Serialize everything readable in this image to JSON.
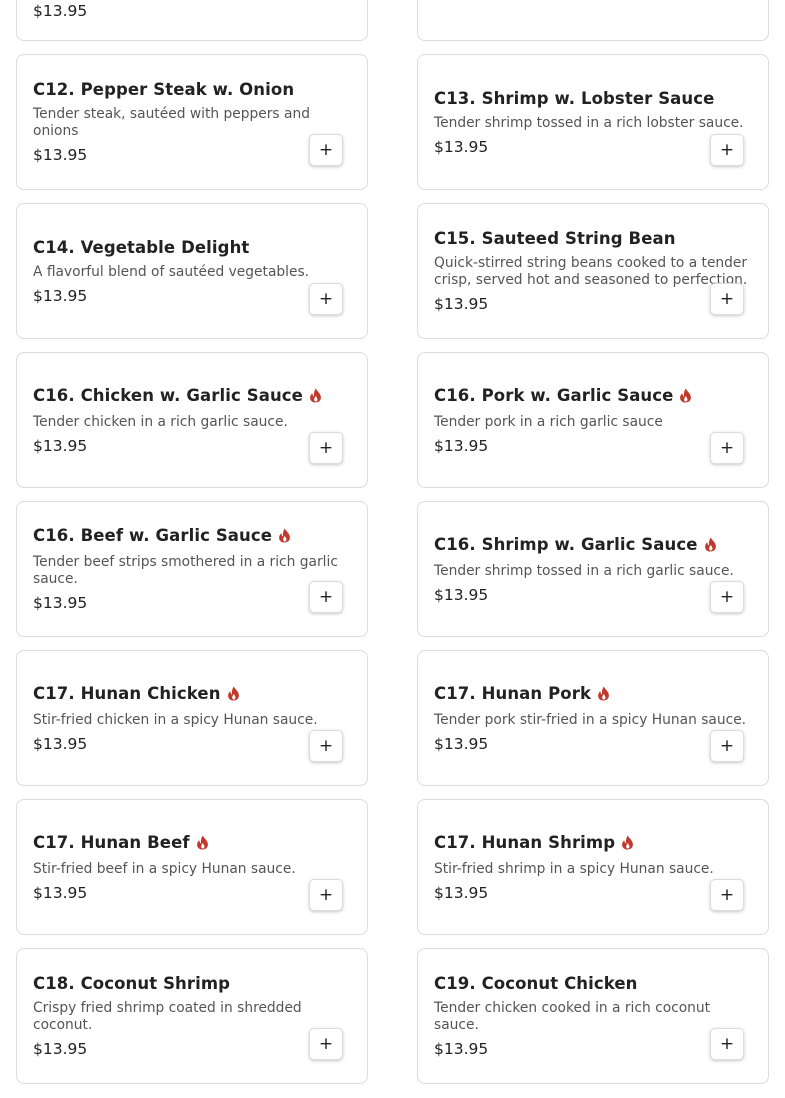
{
  "add_symbol": "+",
  "spicy_color": "#c0392b",
  "items": [
    {
      "title": "",
      "desc": "",
      "price": "$13.95",
      "spicy": false
    },
    {
      "title": "",
      "desc": "",
      "price": "",
      "spicy": false
    },
    {
      "title": "C12. Pepper Steak w. Onion",
      "desc": "Tender steak, sautéed with peppers and onions",
      "price": "$13.95",
      "spicy": false
    },
    {
      "title": "C13. Shrimp w. Lobster Sauce",
      "desc": "Tender shrimp tossed in a rich lobster sauce.",
      "price": "$13.95",
      "spicy": false
    },
    {
      "title": "C14. Vegetable Delight",
      "desc": "A flavorful blend of sautéed vegetables.",
      "price": "$13.95",
      "spicy": false
    },
    {
      "title": "C15. Sauteed String Bean",
      "desc": "Quick-stirred string beans cooked to a tender crisp, served hot and seasoned to perfection.",
      "price": "$13.95",
      "spicy": false
    },
    {
      "title": "C16. Chicken w. Garlic Sauce",
      "desc": "Tender chicken in a rich garlic sauce.",
      "price": "$13.95",
      "spicy": true
    },
    {
      "title": "C16. Pork w. Garlic Sauce",
      "desc": "Tender pork in a rich garlic sauce",
      "price": "$13.95",
      "spicy": true
    },
    {
      "title": "C16. Beef w. Garlic Sauce",
      "desc": "Tender beef strips smothered in a rich garlic sauce.",
      "price": "$13.95",
      "spicy": true
    },
    {
      "title": "C16. Shrimp w. Garlic Sauce",
      "desc": "Tender shrimp tossed in a rich garlic sauce.",
      "price": "$13.95",
      "spicy": true
    },
    {
      "title": "C17. Hunan Chicken",
      "desc": "Stir-fried chicken in a spicy Hunan sauce.",
      "price": "$13.95",
      "spicy": true
    },
    {
      "title": "C17. Hunan Pork",
      "desc": "Tender pork stir-fried in a spicy Hunan sauce.",
      "price": "$13.95",
      "spicy": true
    },
    {
      "title": "C17. Hunan Beef",
      "desc": "Stir-fried beef in a spicy Hunan sauce.",
      "price": "$13.95",
      "spicy": true
    },
    {
      "title": "C17. Hunan Shrimp",
      "desc": "Stir-fried shrimp in a spicy Hunan sauce.",
      "price": "$13.95",
      "spicy": true
    },
    {
      "title": "C18. Coconut Shrimp",
      "desc": "Crispy fried shrimp coated in shredded coconut.",
      "price": "$13.95",
      "spicy": false
    },
    {
      "title": "C19. Coconut Chicken",
      "desc": "Tender chicken cooked in a rich coconut sauce.",
      "price": "$13.95",
      "spicy": false
    }
  ]
}
